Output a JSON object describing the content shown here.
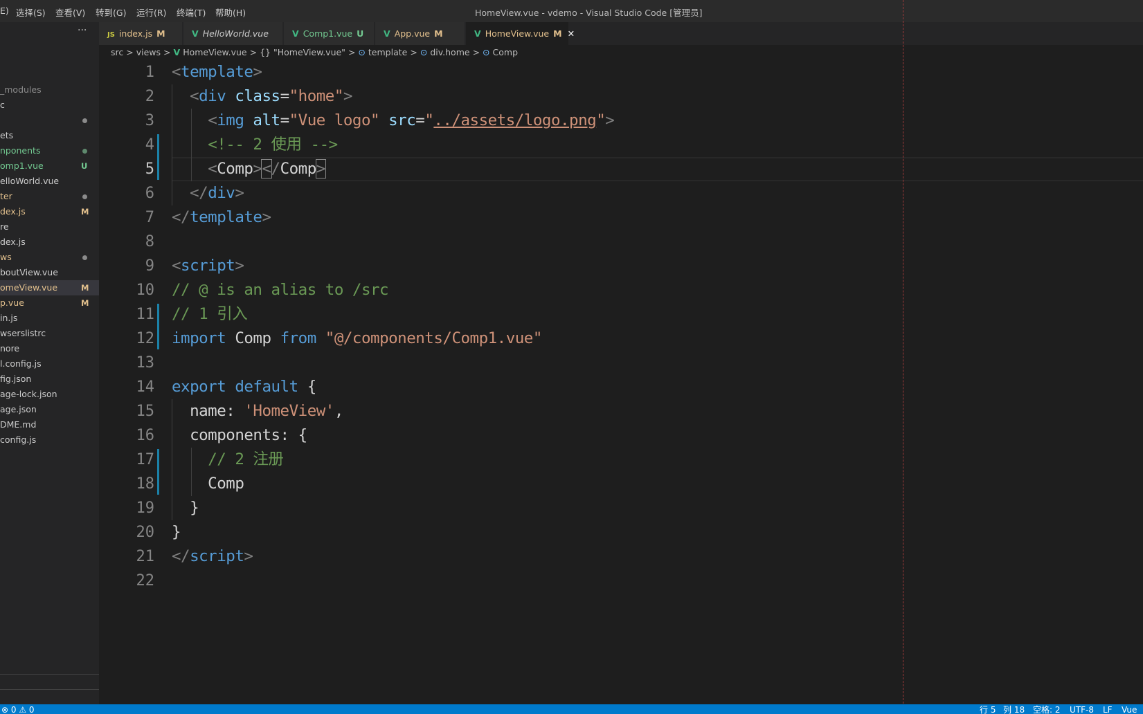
{
  "titlebar": {
    "menus": [
      "E)",
      "选择(S)",
      "查看(V)",
      "转到(G)",
      "运行(R)",
      "终端(T)",
      "帮助(H)"
    ],
    "title": "HomeView.vue - vdemo - Visual Studio Code [管理员]"
  },
  "sidebar": {
    "more": "···",
    "items": [
      {
        "label": "_modules",
        "color": "#8b8b8b"
      },
      {
        "label": "c",
        "color": "#cccccc"
      },
      {
        "label": "",
        "color": "#cccccc",
        "dot": "#8b8b8b"
      },
      {
        "label": "ets",
        "color": "#cccccc"
      },
      {
        "label": "nponents",
        "color": "#73c991",
        "dot": "#5f8a6e"
      },
      {
        "label": "omp1.vue",
        "color": "#73c991",
        "badge": "U",
        "badge_color": "#73c991"
      },
      {
        "label": "elloWorld.vue",
        "color": "#cccccc"
      },
      {
        "label": "ter",
        "color": "#e2c08d",
        "dot": "#8b8b8b"
      },
      {
        "label": "dex.js",
        "color": "#e2c08d",
        "badge": "M",
        "badge_color": "#e2c08d"
      },
      {
        "label": "re",
        "color": "#cccccc"
      },
      {
        "label": "dex.js",
        "color": "#cccccc"
      },
      {
        "label": "ws",
        "color": "#e2c08d",
        "dot": "#8b8b8b"
      },
      {
        "label": "boutView.vue",
        "color": "#cccccc"
      },
      {
        "label": "omeView.vue",
        "color": "#e2c08d",
        "badge": "M",
        "badge_color": "#e2c08d",
        "selected": true
      },
      {
        "label": "p.vue",
        "color": "#e2c08d",
        "badge": "M",
        "badge_color": "#e2c08d"
      },
      {
        "label": "in.js",
        "color": "#cccccc"
      },
      {
        "label": "wserslistrc",
        "color": "#cccccc"
      },
      {
        "label": "nore",
        "color": "#cccccc"
      },
      {
        "label": "l.config.js",
        "color": "#cccccc"
      },
      {
        "label": "fig.json",
        "color": "#cccccc"
      },
      {
        "label": "age-lock.json",
        "color": "#cccccc"
      },
      {
        "label": "age.json",
        "color": "#cccccc"
      },
      {
        "label": "DME.md",
        "color": "#cccccc"
      },
      {
        "label": "config.js",
        "color": "#cccccc"
      }
    ]
  },
  "tabs": [
    {
      "icon": "JS",
      "icon_color": "#cbcb41",
      "label": "index.js",
      "status": "M",
      "color": "#e2c08d"
    },
    {
      "icon": "V",
      "icon_color": "#41b883",
      "label": "HelloWorld.vue",
      "status": "",
      "color": "#cccccc",
      "italic": true
    },
    {
      "icon": "V",
      "icon_color": "#41b883",
      "label": "Comp1.vue",
      "status": "U",
      "color": "#73c991"
    },
    {
      "icon": "V",
      "icon_color": "#41b883",
      "label": "App.vue",
      "status": "M",
      "color": "#e2c08d"
    },
    {
      "icon": "V",
      "icon_color": "#41b883",
      "label": "HomeView.vue",
      "status": "M",
      "color": "#e2c08d",
      "active": true,
      "close": "✕"
    }
  ],
  "breadcrumb": [
    "src",
    ">",
    "views",
    ">",
    "V",
    "HomeView.vue",
    ">",
    "{}",
    "\"HomeView.vue\"",
    ">",
    "⊙",
    "template",
    ">",
    "⊙",
    "div.home",
    ">",
    "⊙",
    "Comp"
  ],
  "editor": {
    "current_line": 5,
    "lines": [
      [
        [
          "<",
          "punc"
        ],
        [
          "template",
          "tag"
        ],
        [
          ">",
          "punc"
        ]
      ],
      [
        [
          "  ",
          "id"
        ],
        [
          "<",
          "punc"
        ],
        [
          "div",
          "tag"
        ],
        [
          " ",
          "id"
        ],
        [
          "class",
          "attr"
        ],
        [
          "=",
          "id"
        ],
        [
          "\"home\"",
          "str"
        ],
        [
          ">",
          "punc"
        ]
      ],
      [
        [
          "    ",
          "id"
        ],
        [
          "<",
          "punc"
        ],
        [
          "img",
          "tag"
        ],
        [
          " ",
          "id"
        ],
        [
          "alt",
          "attr"
        ],
        [
          "=",
          "id"
        ],
        [
          "\"Vue logo\"",
          "str"
        ],
        [
          " ",
          "id"
        ],
        [
          "src",
          "attr"
        ],
        [
          "=",
          "id"
        ],
        [
          "\"",
          "str"
        ],
        [
          "../assets/logo.png",
          "link"
        ],
        [
          "\"",
          "str"
        ],
        [
          ">",
          "punc"
        ]
      ],
      [
        [
          "    ",
          "id"
        ],
        [
          "<!-- 2 使用 -->",
          "com"
        ]
      ],
      [
        [
          "    ",
          "id"
        ],
        [
          "<",
          "punc"
        ],
        [
          "Comp",
          "comp"
        ],
        [
          ">",
          "punc"
        ],
        [
          "<",
          "punc bm"
        ],
        [
          "/",
          "punc"
        ],
        [
          "Comp",
          "comp"
        ],
        [
          ">",
          "punc bm"
        ]
      ],
      [
        [
          "  ",
          "id"
        ],
        [
          "</",
          "punc"
        ],
        [
          "div",
          "tag"
        ],
        [
          ">",
          "punc"
        ]
      ],
      [
        [
          "</",
          "punc"
        ],
        [
          "template",
          "tag"
        ],
        [
          ">",
          "punc"
        ]
      ],
      [],
      [
        [
          "<",
          "punc"
        ],
        [
          "script",
          "tag"
        ],
        [
          ">",
          "punc"
        ]
      ],
      [
        [
          "// @ is an alias to /src",
          "com"
        ]
      ],
      [
        [
          "// 1 引入",
          "com"
        ]
      ],
      [
        [
          "import",
          "kwimp"
        ],
        [
          " Comp ",
          "id"
        ],
        [
          "from",
          "kwimp"
        ],
        [
          " ",
          "id"
        ],
        [
          "\"@/components/Comp1.vue\"",
          "str"
        ]
      ],
      [],
      [
        [
          "export",
          "kw"
        ],
        [
          " ",
          "id"
        ],
        [
          "default",
          "kw"
        ],
        [
          " {",
          "id"
        ]
      ],
      [
        [
          "  name: ",
          "id"
        ],
        [
          "'HomeView'",
          "str"
        ],
        [
          ",",
          "id"
        ]
      ],
      [
        [
          "  components: {",
          "id"
        ]
      ],
      [
        [
          "    ",
          "id"
        ],
        [
          "// 2 注册",
          "com"
        ]
      ],
      [
        [
          "    Comp",
          "id"
        ]
      ],
      [
        [
          "  }",
          "id"
        ]
      ],
      [
        [
          "}",
          "id"
        ]
      ],
      [
        [
          "</",
          "punc"
        ],
        [
          "script",
          "tag"
        ],
        [
          ">",
          "punc"
        ]
      ],
      []
    ]
  },
  "statusbar": {
    "problems": "⊗ 0 ⚠ 0",
    "line": "行 5",
    "col": "列 18",
    "spaces": "空格: 2",
    "encoding": "UTF-8",
    "eol": "LF",
    "language": "Vue"
  }
}
